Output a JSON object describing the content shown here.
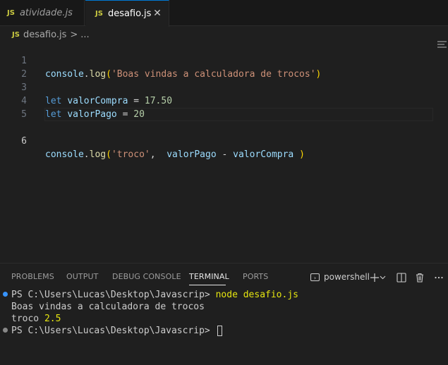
{
  "tabs": [
    {
      "icon": "JS",
      "label": "atividade.js",
      "active": false
    },
    {
      "icon": "JS",
      "label": "desafio.js",
      "active": true,
      "close": "✕"
    }
  ],
  "breadcrumb": {
    "icon": "JS",
    "file": "desafio.js",
    "sep": ">",
    "more": "..."
  },
  "editor": {
    "line_numbers": [
      "1",
      "2",
      "3",
      "4",
      "5",
      "6"
    ],
    "current_line": 6,
    "lines": [
      {
        "obj": "console",
        "dot": ".",
        "fn": "log",
        "open": "(",
        "str": "'Boas vindas a calculadora de trocos'",
        "close": ")"
      },
      {},
      {
        "kw": "let",
        "var": "valorCompra",
        "op": "=",
        "num": "17.50"
      },
      {
        "kw": "let",
        "var": "valorPago",
        "op": "=",
        "num": "20"
      },
      {},
      {
        "obj": "console",
        "dot": ".",
        "fn": "log",
        "open": "(",
        "str": "'troco'",
        "comma": ",",
        "a": "valorPago",
        "minus": "-",
        "b": "valorCompra",
        "close": ")"
      }
    ]
  },
  "panel": {
    "tabs": [
      "PROBLEMS",
      "OUTPUT",
      "DEBUG CONSOLE",
      "TERMINAL",
      "PORTS"
    ],
    "active_tab": "TERMINAL",
    "shell_label": "powershell",
    "icons": [
      "terminal-icon",
      "plus-icon",
      "chevron-down-icon",
      "split-terminal-icon",
      "trash-icon",
      "more-icon"
    ]
  },
  "terminal": {
    "prompt1": "PS C:\\Users\\Lucas\\Desktop\\Javascrip>",
    "cmd1": "node desafio.js",
    "out1": "Boas vindas a calculadora de trocos",
    "out2_text": "troco",
    "out2_num": "2.5",
    "prompt2": "PS C:\\Users\\Lucas\\Desktop\\Javascrip>"
  },
  "colors": {
    "accent": "#0078d4",
    "js": "#cbcb41",
    "dot_done": "#3794ff",
    "dot_idle": "#888888"
  }
}
